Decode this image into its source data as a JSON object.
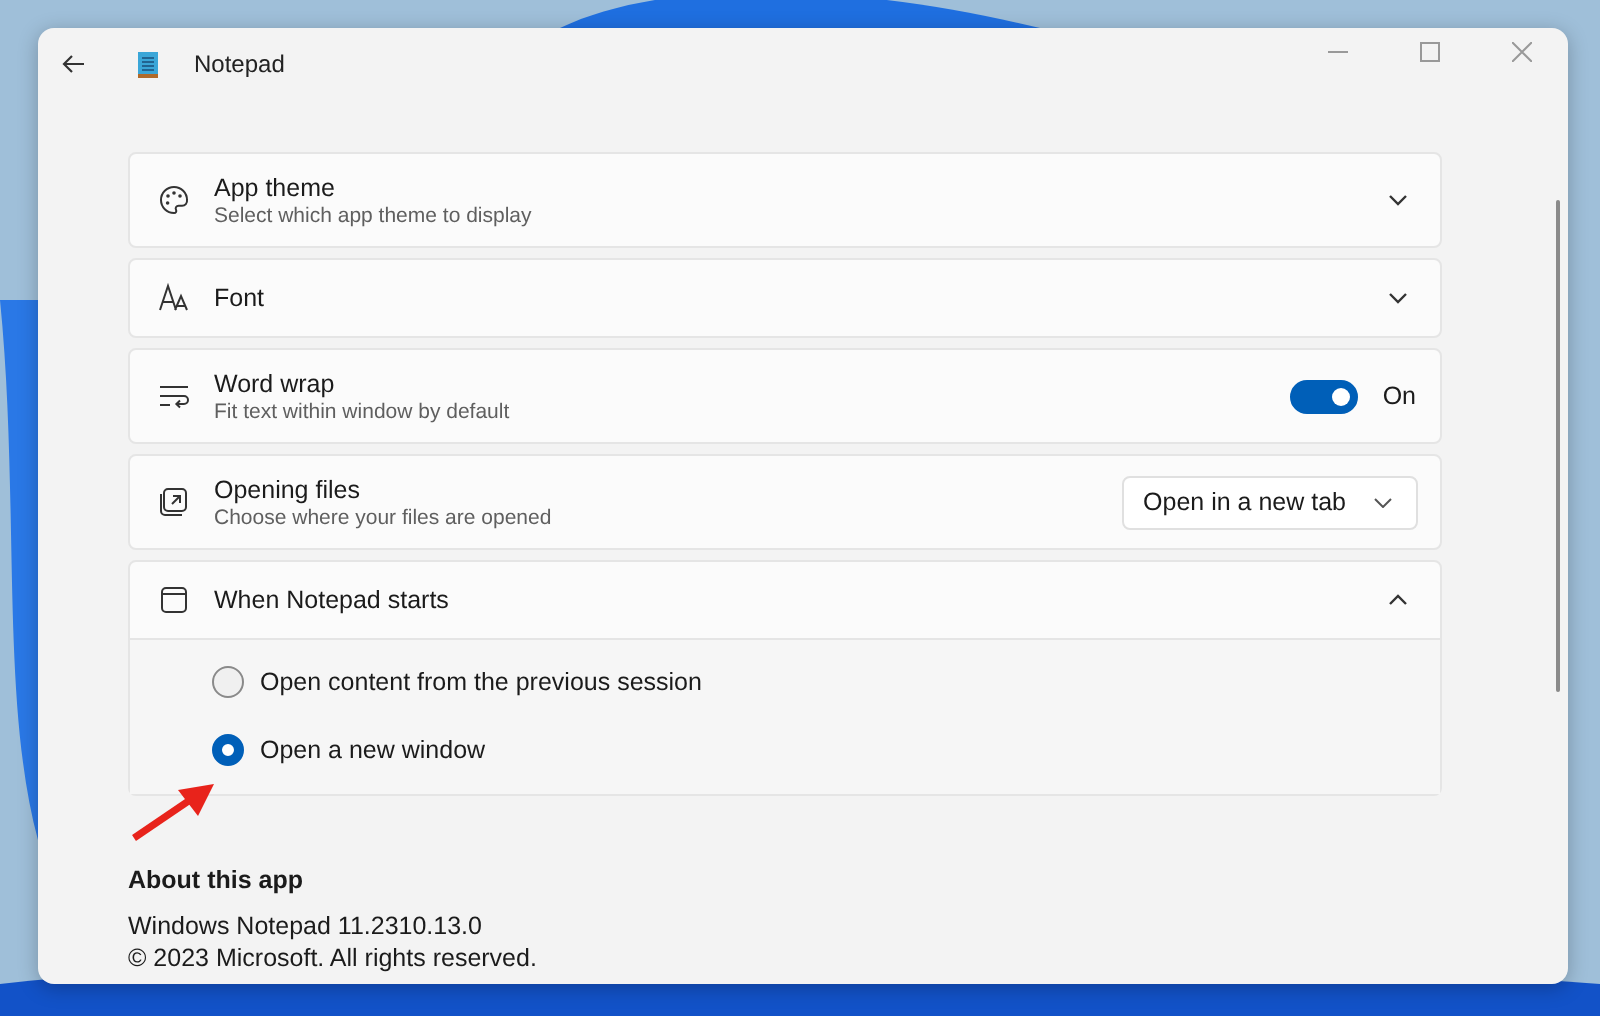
{
  "window": {
    "title": "Notepad"
  },
  "settings": [
    {
      "kind": "expander",
      "title": "App theme",
      "description": "Select which app theme to display",
      "expanded": false
    },
    {
      "kind": "expander",
      "title": "Font",
      "expanded": false
    },
    {
      "kind": "toggle",
      "title": "Word wrap",
      "description": "Fit text within window by default",
      "on": true,
      "state_label": "On"
    },
    {
      "kind": "dropdown",
      "title": "Opening files",
      "description": "Choose where your files are opened",
      "value": "Open in a new tab"
    },
    {
      "kind": "expander",
      "title": "When Notepad starts",
      "expanded": true,
      "options": [
        {
          "label": "Open content from the previous session",
          "selected": false
        },
        {
          "label": "Open a new window",
          "selected": true
        }
      ]
    }
  ],
  "about": {
    "heading": "About this app",
    "version": "Windows Notepad 11.2310.13.0",
    "copyright": "© 2023 Microsoft. All rights reserved."
  }
}
